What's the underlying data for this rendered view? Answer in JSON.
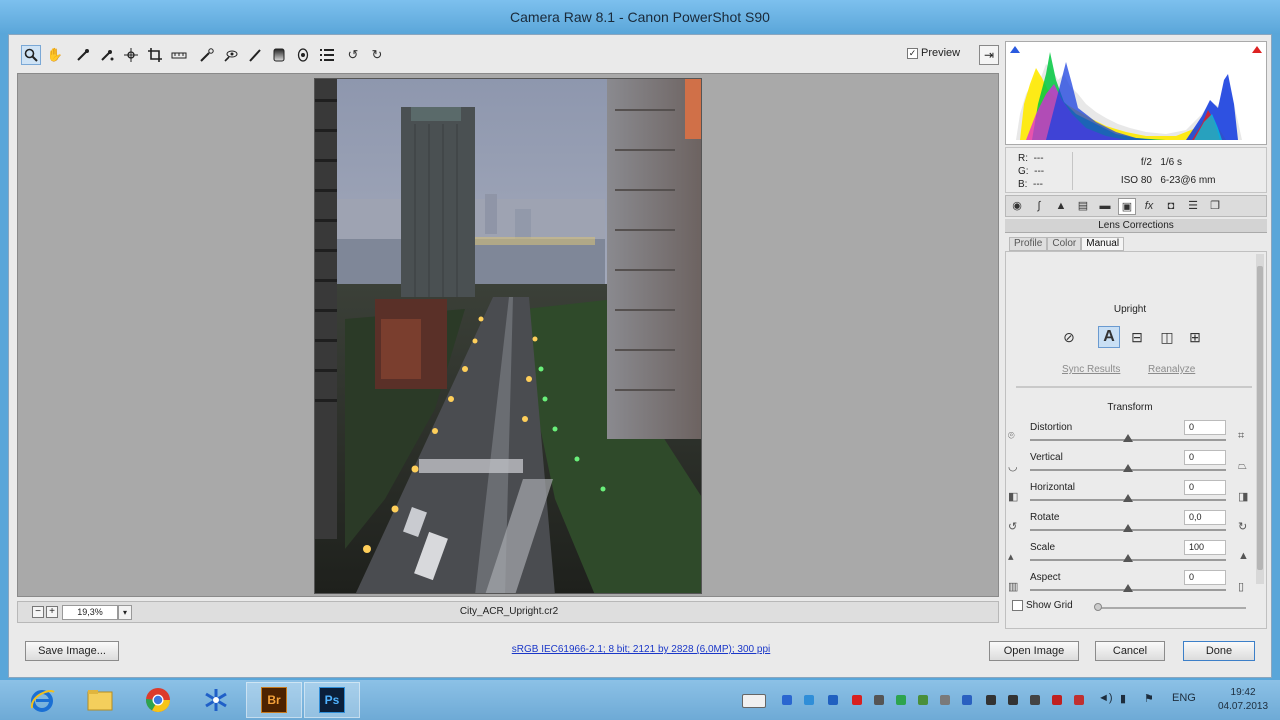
{
  "window": {
    "title": "Camera Raw 8.1  -  Canon PowerShot S90"
  },
  "toolbar": {
    "tools": [
      "zoom-icon",
      "hand-icon",
      "white-balance-icon",
      "color-sampler-icon",
      "targeted-adjustment-icon",
      "crop-icon",
      "straighten-icon",
      "spot-removal-icon",
      "red-eye-icon",
      "adjustment-brush-icon",
      "graduated-filter-icon",
      "radial-filter-icon",
      "preferences-icon",
      "rotate-ccw-icon",
      "rotate-cw-icon"
    ],
    "preview_label": "Preview",
    "preview_checked": "✓"
  },
  "preview": {
    "zoom_value": "19,3%",
    "filename": "City_ACR_Upright.cr2"
  },
  "info": {
    "r_label": "R:",
    "r_value": "---",
    "g_label": "G:",
    "g_value": "---",
    "b_label": "B:",
    "b_value": "---",
    "aperture": "f/2",
    "shutter": "1/6 s",
    "iso": "ISO 80",
    "focal": "6-23@6 mm"
  },
  "panel": {
    "title": "Lens Corrections",
    "subtabs": [
      "Profile",
      "Color",
      "Manual"
    ],
    "active_subtab": "Manual",
    "upright_label": "Upright",
    "upright_active": "A",
    "sync_label": "Sync Results",
    "reanalyze_label": "Reanalyze",
    "transform_label": "Transform",
    "sliders": [
      {
        "name": "Distortion",
        "value": "0",
        "fraction": 0.5
      },
      {
        "name": "Vertical",
        "value": "0",
        "fraction": 0.5
      },
      {
        "name": "Horizontal",
        "value": "0",
        "fraction": 0.5
      },
      {
        "name": "Rotate",
        "value": "0,0",
        "fraction": 0.5
      },
      {
        "name": "Scale",
        "value": "100",
        "fraction": 0.5
      },
      {
        "name": "Aspect",
        "value": "0",
        "fraction": 0.5
      }
    ],
    "show_grid_label": "Show Grid"
  },
  "bottom": {
    "save_label": "Save Image...",
    "workflow_link": "sRGB IEC61966-2.1; 8 bit; 2121 by 2828 (6,0MP); 300 ppi",
    "open_label": "Open Image",
    "cancel_label": "Cancel",
    "done_label": "Done"
  },
  "taskbar": {
    "lang": "ENG",
    "time": "19:42",
    "date": "04.07.2013"
  }
}
